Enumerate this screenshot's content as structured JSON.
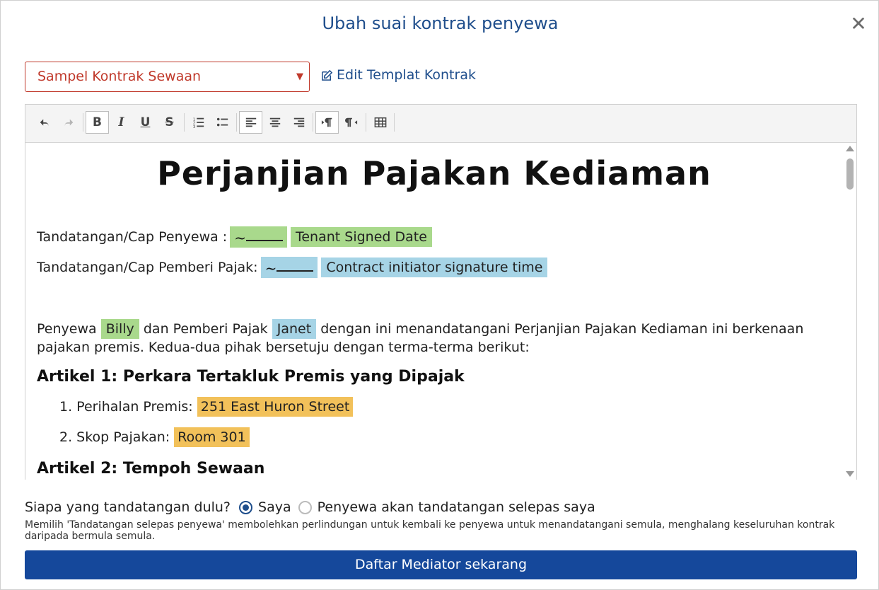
{
  "modal": {
    "title": "Ubah suai kontrak penyewa",
    "close_symbol": "✕"
  },
  "template_select": {
    "selected": "Sampel Kontrak Sewaan"
  },
  "edit_template_label": "Edit Templat Kontrak",
  "toolbar": {
    "buttons": [
      "undo-icon",
      "redo-icon",
      "bold",
      "italic",
      "underline",
      "strikethrough",
      "ordered-list-icon",
      "bullet-list-icon",
      "align-left-icon",
      "align-center-icon",
      "align-right-icon",
      "ltr-icon",
      "rtl-icon",
      "table-icon"
    ],
    "bold_label": "B",
    "italic_label": "I",
    "underline_label": "U",
    "strike_label": "S"
  },
  "document": {
    "title": "Perjanjian Pajakan Kediaman",
    "tenant_sign_label": "Tandatangan/Cap Penyewa :",
    "tenant_date_tag": "Tenant Signed Date",
    "landlord_sign_label": "Tandatangan/Cap Pemberi Pajak:",
    "landlord_time_tag": "Contract initiator signature time",
    "intro_part1": "Penyewa",
    "tenant_name": "Billy",
    "intro_part2": "dan Pemberi Pajak",
    "landlord_name": "Janet",
    "intro_part3": "dengan ini menandatangani Perjanjian Pajakan Kediaman ini berkenaan pajakan premis. Kedua-dua pihak bersetuju dengan terma-terma berikut:",
    "article1": "Artikel 1: Perkara Tertakluk Premis yang Dipajak",
    "item1_label": "1. Perihalan Premis:",
    "item1_value": "251 East Huron Street",
    "item2_label": "2. Skop Pajakan:",
    "item2_value": "Room 301",
    "article2": "Artikel 2: Tempoh Sewaan"
  },
  "signing": {
    "question": "Siapa yang tandatangan dulu?",
    "option_me": "Saya",
    "option_tenant": "Penyewa akan tandatangan selepas saya",
    "selected": "Saya",
    "note": "Memilih 'Tandatangan selepas penyewa' membolehkan perlindungan untuk kembali ke penyewa untuk menandatangani semula, menghalang keseluruhan kontrak daripada bermula semula."
  },
  "cta": {
    "label": "Daftar Mediator sekarang"
  },
  "colors": {
    "accent": "#1f4e8c",
    "button": "#15489b",
    "select_border": "#c0392b",
    "tag_green": "#a9d98c",
    "tag_blue": "#a6d4e6",
    "tag_orange": "#f2c15a"
  }
}
